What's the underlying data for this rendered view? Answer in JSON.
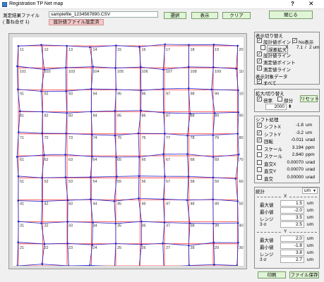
{
  "window": {
    "title": "Registration TP Net map",
    "help": "?",
    "close": "✕"
  },
  "header": {
    "measure_label": "測定結果ファイル",
    "overlay_label": "( 重ね合せ 1)",
    "file_value": "samplefile_1234567890.CSV",
    "design_file_button": "設計値ファイル設定済",
    "select_button": "選択",
    "display_button": "表示",
    "clear_button": "クリア",
    "close_button": "閉じる"
  },
  "map": {
    "top_labels": [
      "11",
      "12",
      "13",
      "14",
      "15",
      "16",
      "17",
      "18",
      "19",
      "20"
    ],
    "row2_labels": [
      "101",
      "102",
      "103",
      "104",
      "105",
      "106",
      "107",
      "108",
      "109",
      "110"
    ],
    "row_labels": [
      [
        "91",
        "92",
        "93",
        "94",
        "95",
        "96",
        "97",
        "98",
        "99",
        "100"
      ],
      [
        "81",
        "82",
        "83",
        "84",
        "85",
        "86",
        "87",
        "88",
        "89",
        "90"
      ],
      [
        "71",
        "72",
        "73",
        "74",
        "75",
        "76",
        "77",
        "78",
        "79",
        "80"
      ],
      [
        "61",
        "62",
        "63",
        "64",
        "65",
        "66",
        "67",
        "68",
        "69",
        "70"
      ],
      [
        "51",
        "52",
        "53",
        "54",
        "55",
        "56",
        "57",
        "58",
        "59",
        "60"
      ],
      [
        "41",
        "42",
        "43",
        "44",
        "45",
        "46",
        "47",
        "48",
        "49",
        "50"
      ],
      [
        "31",
        "32",
        "33",
        "34",
        "35",
        "36",
        "37",
        "38",
        "39",
        "40"
      ],
      [
        "21",
        "22",
        "23",
        "24",
        "25",
        "26",
        "27",
        "28",
        "29",
        "30"
      ],
      [
        "1",
        "2",
        "3",
        "4",
        "5",
        "6",
        "7",
        "8",
        "9",
        "10"
      ]
    ],
    "colors": {
      "design": "#ff3333",
      "measured": "#2222cc",
      "background": "#dddddd"
    }
  },
  "display_panel": {
    "title": "表示切り替え",
    "design_point": "設計値ポイント",
    "no_display": "No表示",
    "error_expand": "誤差拡大",
    "error_x": "X",
    "error_value": "7.1",
    "error_sep": "/",
    "error_unit": "2 um",
    "design_line": "設計値ライン",
    "measured_point": "測定値ポイント",
    "measured_line": "測定値ライン",
    "target_label": "表示対象データ",
    "target_all": "すべて"
  },
  "zoom_panel": {
    "title": "拡大/切り替え",
    "magnification": "倍率",
    "partial": "部分",
    "reset": "リセット",
    "value": "2000"
  },
  "shift_panel": {
    "title": "シフト処理",
    "rows": [
      {
        "label": "シフトX",
        "value": "-1.8",
        "unit": "um",
        "checked": true
      },
      {
        "label": "シフトY",
        "value": "-3.2",
        "unit": "um",
        "checked": true
      },
      {
        "label": "回転",
        "value": "-0.011",
        "unit": "urad",
        "checked": true
      },
      {
        "label": "スケール",
        "value": "3.194",
        "unit": "ppm",
        "checked": false
      },
      {
        "label": "スケール",
        "value": "2.840",
        "unit": "ppm",
        "checked": false
      },
      {
        "label": "直交X",
        "value": "0.00070",
        "unit": "urad",
        "checked": false
      },
      {
        "label": "直交Y",
        "value": "0.00070",
        "unit": "urad",
        "checked": false
      },
      {
        "label": "直交",
        "value": "0.00000",
        "unit": "urad",
        "checked": false
      }
    ]
  },
  "stats_panel": {
    "title": "統計",
    "unit": "um",
    "x_header": "X",
    "y_header": "Y",
    "x_rows": [
      {
        "label": "最大値",
        "value": "1.5",
        "unit": "um"
      },
      {
        "label": "最小値",
        "value": "-2.0",
        "unit": "um"
      },
      {
        "label": "レンジ",
        "value": "3.5",
        "unit": "um"
      },
      {
        "label": "3 σ",
        "value": "2.5",
        "unit": "um"
      }
    ],
    "y_rows": [
      {
        "label": "最大値",
        "value": "2.0",
        "unit": "um"
      },
      {
        "label": "最小値",
        "value": "-1.8",
        "unit": "um"
      },
      {
        "label": "レンジ",
        "value": "3.8",
        "unit": "um"
      },
      {
        "label": "3 σ",
        "value": "2.7",
        "unit": "um"
      }
    ]
  },
  "footer": {
    "print_button": "印刷",
    "save_button": "ファイル保存"
  }
}
